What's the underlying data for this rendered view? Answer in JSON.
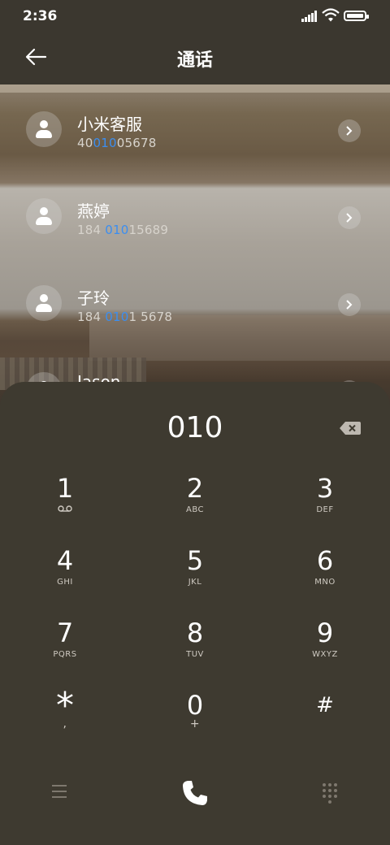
{
  "status_bar": {
    "time": "2:36"
  },
  "header": {
    "title": "通话"
  },
  "contacts": [
    {
      "name": "小米客服",
      "number_pre": "40",
      "number_hl": "010",
      "number_post": "05678"
    },
    {
      "name": "燕婷",
      "number_pre": "184 ",
      "number_hl": "010",
      "number_post": "15689"
    },
    {
      "name": "子玲",
      "number_pre": "184 ",
      "number_hl": "010",
      "number_post": "1 5678"
    },
    {
      "name": "Jason",
      "number_pre": "",
      "number_hl": "",
      "number_post": ""
    }
  ],
  "dialer": {
    "entry": "010",
    "keys": [
      {
        "digit": "1",
        "letters": ""
      },
      {
        "digit": "2",
        "letters": "ABC"
      },
      {
        "digit": "3",
        "letters": "DEF"
      },
      {
        "digit": "4",
        "letters": "GHI"
      },
      {
        "digit": "5",
        "letters": "JKL"
      },
      {
        "digit": "6",
        "letters": "MNO"
      },
      {
        "digit": "7",
        "letters": "PQRS"
      },
      {
        "digit": "8",
        "letters": "TUV"
      },
      {
        "digit": "9",
        "letters": "WXYZ"
      },
      {
        "digit": "*",
        "letters": ","
      },
      {
        "digit": "0",
        "letters": "+"
      },
      {
        "digit": "#",
        "letters": ""
      }
    ]
  },
  "colors": {
    "highlight": "#3b8ef0",
    "sheet": "#3e3a30",
    "header": "#3b372f"
  },
  "icons": [
    "back-arrow-icon",
    "person-icon",
    "chevron-right-icon",
    "backspace-icon",
    "voicemail-icon",
    "menu-icon",
    "phone-icon",
    "dialpad-icon"
  ]
}
